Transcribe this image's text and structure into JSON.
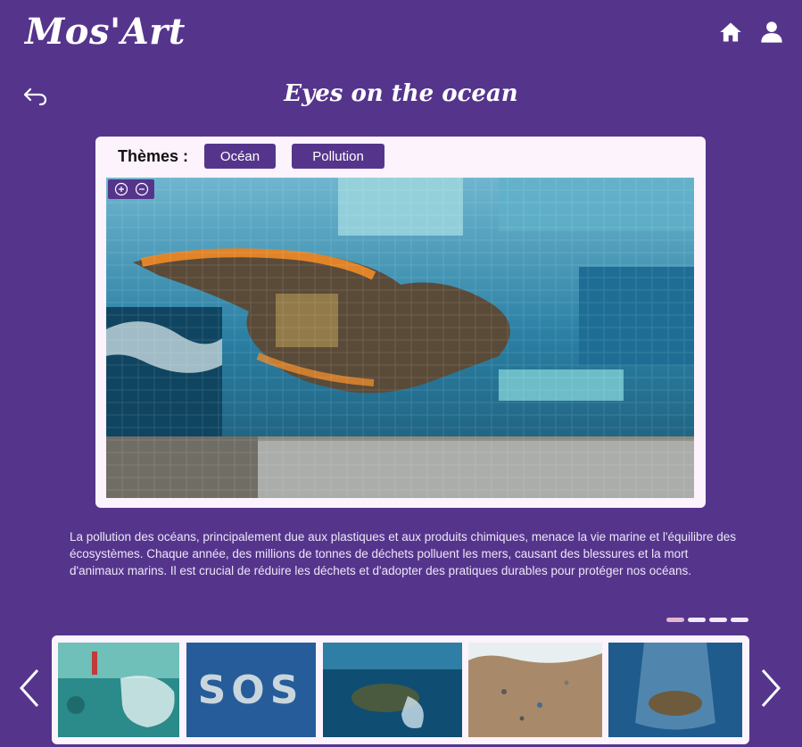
{
  "app": {
    "logo": "Mos'Art",
    "home_icon": "home-icon",
    "user_icon": "user-icon"
  },
  "page": {
    "title": "Eyes on the ocean",
    "back_icon": "back-arrow-icon"
  },
  "themes": {
    "label": "Thèmes :",
    "tags": [
      "Océan",
      "Pollution"
    ]
  },
  "mosaic": {
    "zoom_in_icon": "zoom-in-icon",
    "zoom_out_icon": "zoom-out-icon"
  },
  "description": "La pollution des océans, principalement due aux plastiques et aux produits chimiques, menace la vie marine et l'équilibre des écosystèmes. Chaque année, des millions de tonnes de déchets polluent les mers, causant des blessures et la mort d'animaux marins. Il est crucial de réduire les déchets et d'adopter des pratiques durables pour protéger nos océans.",
  "carousel": {
    "page_count": 4,
    "active_page": 1,
    "thumbnails": [
      "plastic-bag-underwater",
      "sos-written-in-stones",
      "sea-turtle-with-plastic",
      "litter-on-beach",
      "turtle-in-plastic-bag"
    ],
    "prev_icon": "chevron-left-icon",
    "next_icon": "chevron-right-icon"
  },
  "colors": {
    "background": "#55358c",
    "card": "#fcf3fc",
    "accent": "#55358c",
    "active_dot": "#e3b6cf"
  }
}
